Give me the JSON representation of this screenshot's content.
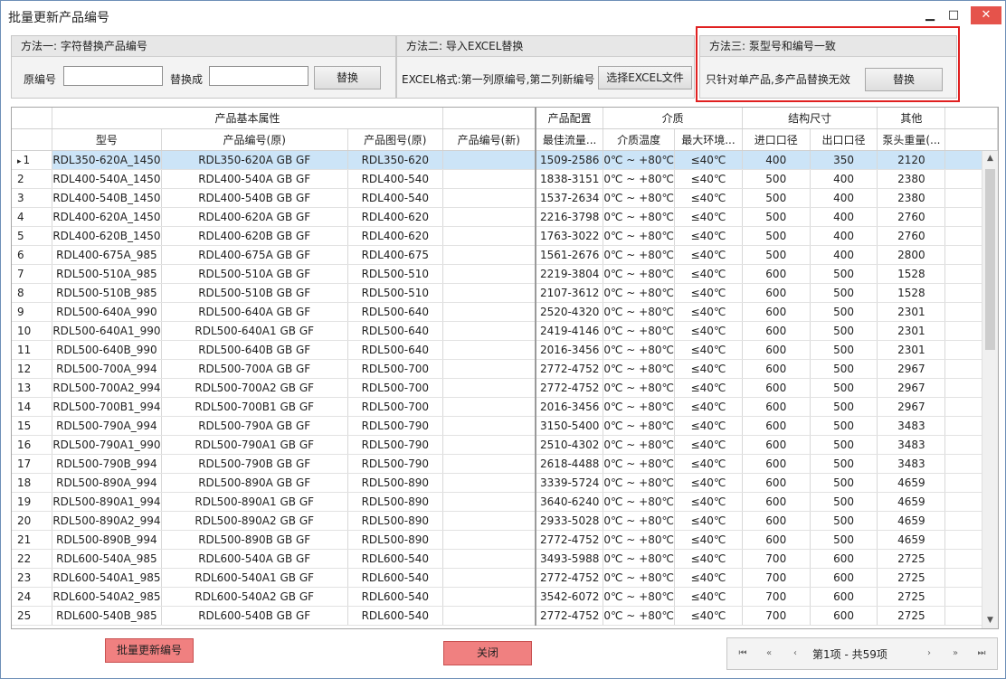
{
  "window": {
    "title": "批量更新产品编号",
    "minimize": "▁",
    "maximize": "□",
    "close": "✕"
  },
  "method1": {
    "title": "方法一: 字符替换产品编号",
    "original_label": "原编号",
    "replace_label": "替换成",
    "original_value": "",
    "replace_value": "",
    "button": "替换"
  },
  "method2": {
    "title": "方法二: 导入EXCEL替换",
    "desc": "EXCEL格式:第一列原编号,第二列新编号",
    "button": "选择EXCEL文件"
  },
  "method3": {
    "title": "方法三: 泵型号和编号一致",
    "desc": "只针对单产品,多产品替换无效",
    "button": "替换"
  },
  "grid": {
    "bands": [
      "产品基本属性",
      "产品配置",
      "介质",
      "结构尺寸",
      "其他"
    ],
    "columns": [
      "型号",
      "产品编号(原)",
      "产品图号(原)",
      "产品编号(新)",
      "最佳流量...",
      "介质温度",
      "最大环境...",
      "进口口径",
      "出口口径",
      "泵头重量(..."
    ],
    "rows": [
      [
        "1",
        "RDL350-620A_1450",
        "RDL350-620A GB GF",
        "RDL350-620",
        "",
        "1509-2586",
        "0℃ ~ +80℃",
        "≤40℃",
        "400",
        "350",
        "2120"
      ],
      [
        "2",
        "RDL400-540A_1450",
        "RDL400-540A GB GF",
        "RDL400-540",
        "",
        "1838-3151",
        "0℃ ~ +80℃",
        "≤40℃",
        "500",
        "400",
        "2380"
      ],
      [
        "3",
        "RDL400-540B_1450",
        "RDL400-540B GB GF",
        "RDL400-540",
        "",
        "1537-2634",
        "0℃ ~ +80℃",
        "≤40℃",
        "500",
        "400",
        "2380"
      ],
      [
        "4",
        "RDL400-620A_1450",
        "RDL400-620A GB GF",
        "RDL400-620",
        "",
        "2216-3798",
        "0℃ ~ +80℃",
        "≤40℃",
        "500",
        "400",
        "2760"
      ],
      [
        "5",
        "RDL400-620B_1450",
        "RDL400-620B GB GF",
        "RDL400-620",
        "",
        "1763-3022",
        "0℃ ~ +80℃",
        "≤40℃",
        "500",
        "400",
        "2760"
      ],
      [
        "6",
        "RDL400-675A_985",
        "RDL400-675A GB GF",
        "RDL400-675",
        "",
        "1561-2676",
        "0℃ ~ +80℃",
        "≤40℃",
        "500",
        "400",
        "2800"
      ],
      [
        "7",
        "RDL500-510A_985",
        "RDL500-510A GB GF",
        "RDL500-510",
        "",
        "2219-3804",
        "0℃ ~ +80℃",
        "≤40℃",
        "600",
        "500",
        "1528"
      ],
      [
        "8",
        "RDL500-510B_985",
        "RDL500-510B GB GF",
        "RDL500-510",
        "",
        "2107-3612",
        "0℃ ~ +80℃",
        "≤40℃",
        "600",
        "500",
        "1528"
      ],
      [
        "9",
        "RDL500-640A_990",
        "RDL500-640A GB GF",
        "RDL500-640",
        "",
        "2520-4320",
        "0℃ ~ +80℃",
        "≤40℃",
        "600",
        "500",
        "2301"
      ],
      [
        "10",
        "RDL500-640A1_990",
        "RDL500-640A1 GB GF",
        "RDL500-640",
        "",
        "2419-4146",
        "0℃ ~ +80℃",
        "≤40℃",
        "600",
        "500",
        "2301"
      ],
      [
        "11",
        "RDL500-640B_990",
        "RDL500-640B GB GF",
        "RDL500-640",
        "",
        "2016-3456",
        "0℃ ~ +80℃",
        "≤40℃",
        "600",
        "500",
        "2301"
      ],
      [
        "12",
        "RDL500-700A_994",
        "RDL500-700A GB GF",
        "RDL500-700",
        "",
        "2772-4752",
        "0℃ ~ +80℃",
        "≤40℃",
        "600",
        "500",
        "2967"
      ],
      [
        "13",
        "RDL500-700A2_994",
        "RDL500-700A2 GB GF",
        "RDL500-700",
        "",
        "2772-4752",
        "0℃ ~ +80℃",
        "≤40℃",
        "600",
        "500",
        "2967"
      ],
      [
        "14",
        "RDL500-700B1_994",
        "RDL500-700B1 GB GF",
        "RDL500-700",
        "",
        "2016-3456",
        "0℃ ~ +80℃",
        "≤40℃",
        "600",
        "500",
        "2967"
      ],
      [
        "15",
        "RDL500-790A_994",
        "RDL500-790A GB GF",
        "RDL500-790",
        "",
        "3150-5400",
        "0℃ ~ +80℃",
        "≤40℃",
        "600",
        "500",
        "3483"
      ],
      [
        "16",
        "RDL500-790A1_990",
        "RDL500-790A1 GB GF",
        "RDL500-790",
        "",
        "2510-4302",
        "0℃ ~ +80℃",
        "≤40℃",
        "600",
        "500",
        "3483"
      ],
      [
        "17",
        "RDL500-790B_994",
        "RDL500-790B GB GF",
        "RDL500-790",
        "",
        "2618-4488",
        "0℃ ~ +80℃",
        "≤40℃",
        "600",
        "500",
        "3483"
      ],
      [
        "18",
        "RDL500-890A_994",
        "RDL500-890A GB GF",
        "RDL500-890",
        "",
        "3339-5724",
        "0℃ ~ +80℃",
        "≤40℃",
        "600",
        "500",
        "4659"
      ],
      [
        "19",
        "RDL500-890A1_994",
        "RDL500-890A1 GB GF",
        "RDL500-890",
        "",
        "3640-6240",
        "0℃ ~ +80℃",
        "≤40℃",
        "600",
        "500",
        "4659"
      ],
      [
        "20",
        "RDL500-890A2_994",
        "RDL500-890A2 GB GF",
        "RDL500-890",
        "",
        "2933-5028",
        "0℃ ~ +80℃",
        "≤40℃",
        "600",
        "500",
        "4659"
      ],
      [
        "21",
        "RDL500-890B_994",
        "RDL500-890B GB GF",
        "RDL500-890",
        "",
        "2772-4752",
        "0℃ ~ +80℃",
        "≤40℃",
        "600",
        "500",
        "4659"
      ],
      [
        "22",
        "RDL600-540A_985",
        "RDL600-540A GB GF",
        "RDL600-540",
        "",
        "3493-5988",
        "0℃ ~ +80℃",
        "≤40℃",
        "700",
        "600",
        "2725"
      ],
      [
        "23",
        "RDL600-540A1_985",
        "RDL600-540A1 GB GF",
        "RDL600-540",
        "",
        "2772-4752",
        "0℃ ~ +80℃",
        "≤40℃",
        "700",
        "600",
        "2725"
      ],
      [
        "24",
        "RDL600-540A2_985",
        "RDL600-540A2 GB GF",
        "RDL600-540",
        "",
        "3542-6072",
        "0℃ ~ +80℃",
        "≤40℃",
        "700",
        "600",
        "2725"
      ],
      [
        "25",
        "RDL600-540B_985",
        "RDL600-540B GB GF",
        "RDL600-540",
        "",
        "2772-4752",
        "0℃ ~ +80℃",
        "≤40℃",
        "700",
        "600",
        "2725"
      ]
    ],
    "selected_row": 1,
    "row_indicator": "▸"
  },
  "footer": {
    "update_button": "批量更新编号",
    "close_button": "关闭",
    "pager_text": "第1项 - 共59项",
    "pager_icons": {
      "first": "⏮",
      "prev_page": "«",
      "prev": "‹",
      "next": "›",
      "next_page": "»",
      "last": "⏭"
    }
  },
  "colors": {
    "highlight_border": "#e02020",
    "selected_row": "#cce4f7",
    "footer_button": "#f08080"
  }
}
